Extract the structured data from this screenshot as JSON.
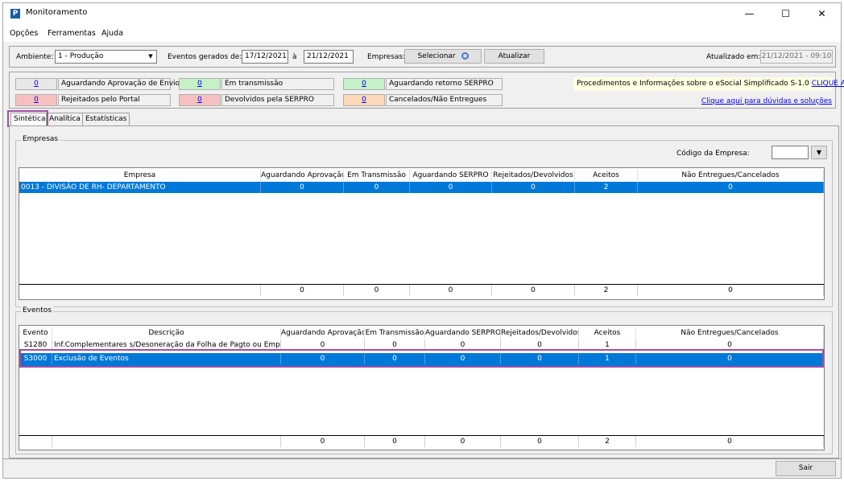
{
  "window": {
    "title": "Monitoramento",
    "minimize": "—",
    "maximize": "☐",
    "close": "✕"
  },
  "menu": [
    "Opções",
    "Ferramentas",
    "Ajuda"
  ],
  "toolbar": {
    "ambiente_label": "Ambiente:",
    "ambiente_value": "1 - Produção",
    "eventos_label": "Eventos gerados de:",
    "date_from": "17/12/2021",
    "date_sep": "à",
    "date_to": "21/12/2021",
    "empresas_label": "Empresas:",
    "selecionar_label": "Selecionar",
    "atualizar_label": "Atualizar",
    "atualizado_label": "Atualizado em:",
    "atualizado_value": "21/12/2021 - 09:10"
  },
  "status_legend": [
    {
      "count": "0",
      "label": "Aguardando Aprovação de Envio",
      "color": "#e8e8e8"
    },
    {
      "count": "0",
      "label": "Em transmissão",
      "color": "#c6f0c6"
    },
    {
      "count": "0",
      "label": "Aguardando retorno SERPRO",
      "color": "#c6f0c6"
    },
    {
      "count": "0",
      "label": "Rejeitados pelo Portal",
      "color": "#f7c0c0"
    },
    {
      "count": "0",
      "label": "Devolvidos pela SERPRO",
      "color": "#f7c0c0"
    },
    {
      "count": "0",
      "label": "Cancelados/Não Entregues",
      "color": "#fad8b8"
    }
  ],
  "info": {
    "text": "Procedimentos e Informações sobre o eSocial Simplificado S-1.0",
    "link": "CLIQUE AQUI",
    "help_link": "Clique aqui para dúvidas e soluções"
  },
  "tabs": [
    "Sintética",
    "Analítica",
    "Estatísticas"
  ],
  "empresas": {
    "group_title": "Empresas",
    "codigo_label": "Código da Empresa:",
    "columns": [
      "Empresa",
      "Aguardando Aprovação",
      "Em Transmissão",
      "Aguardando SERPRO",
      "Rejeitados/Devolvidos",
      "Aceitos",
      "Não Entregues/Cancelados"
    ],
    "rows": [
      [
        "0013 - DIVISÃO DE RH- DEPARTAMENTO",
        "0",
        "0",
        "0",
        "0",
        "2",
        "0"
      ]
    ],
    "totals": [
      "",
      "0",
      "0",
      "0",
      "0",
      "2",
      "0"
    ]
  },
  "eventos": {
    "group_title": "Eventos",
    "columns": [
      "Evento",
      "Descrição",
      "Aguardando Aprovação",
      "Em Transmissão",
      "Aguardando SERPRO",
      "Rejeitados/Devolvidos",
      "Aceitos",
      "Não Entregues/Cancelados"
    ],
    "rows": [
      [
        "S1280",
        "Inf.Complementares s/Desoneração da Folha de Pagto ou Empresa SII",
        "0",
        "0",
        "0",
        "0",
        "1",
        "0"
      ],
      [
        "S3000",
        "Exclusão de Eventos",
        "0",
        "0",
        "0",
        "0",
        "1",
        "0"
      ]
    ],
    "totals": [
      "",
      "",
      "0",
      "0",
      "0",
      "0",
      "2",
      "0"
    ]
  },
  "sair_label": "Sair",
  "colors": {
    "selection": "#0078d7",
    "highlight": "#a24ea8"
  }
}
